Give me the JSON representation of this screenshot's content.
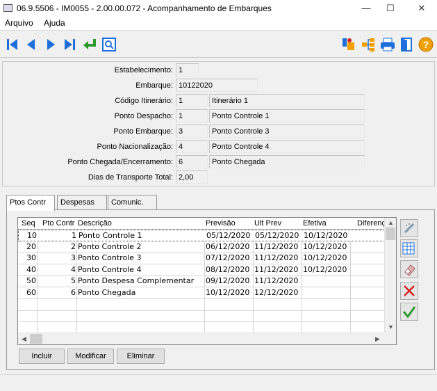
{
  "window": {
    "title": "06.9.5506 - IM0055 - 2.00.00.072 - Acompanhamento de Embarques",
    "minimize": "—",
    "maximize": "☐",
    "close": "✕"
  },
  "menu": [
    "Arquivo",
    "Ajuda"
  ],
  "toolbar": {
    "left": [
      "first-record-icon",
      "previous-record-icon",
      "next-record-icon",
      "last-record-icon",
      "goto-return-icon",
      "search-zoom-icon"
    ],
    "right": [
      "tools-icon",
      "tree-structure-icon",
      "print-icon",
      "exit-door-icon",
      "help-icon"
    ],
    "help_glyph": "?"
  },
  "form": {
    "estabelecimento": {
      "label": "Estabelecimento:",
      "value": "1"
    },
    "embarque": {
      "label": "Embarque:",
      "value": "10122020"
    },
    "codigo_itinerario": {
      "label": "Código Itinerário:",
      "value": "1",
      "desc": "Itinerário 1"
    },
    "ponto_despacho": {
      "label": "Ponto Despacho:",
      "value": "1",
      "desc": "Ponto Controle 1"
    },
    "ponto_embarque": {
      "label": "Ponto Embarque:",
      "value": "3",
      "desc": "Ponto Controle 3"
    },
    "ponto_nacionalizacao": {
      "label": "Ponto Nacionalização:",
      "value": "4",
      "desc": "Ponto Controle 4"
    },
    "ponto_chegada": {
      "label": "Ponto Chegada/Encerramento:",
      "value": "6",
      "desc": "Ponto Chegada"
    },
    "dias_transporte": {
      "label": "Dias de Transporte Total:",
      "value": "2,00"
    }
  },
  "tabs": [
    "Ptos Contr",
    "Despesas",
    "Comunic."
  ],
  "grid": {
    "columns": [
      "Seq",
      "Pto Contr",
      "Descrição",
      "Previsão",
      "Ult Prev",
      "Efetiva",
      "Diferenç"
    ],
    "rows": [
      [
        "10",
        "1",
        "Ponto Controle 1",
        "05/12/2020",
        "05/12/2020",
        "10/12/2020",
        ""
      ],
      [
        "20",
        "2",
        "Ponto Controle 2",
        "06/12/2020",
        "11/12/2020",
        "10/12/2020",
        ""
      ],
      [
        "30",
        "3",
        "Ponto Controle 3",
        "07/12/2020",
        "11/12/2020",
        "10/12/2020",
        ""
      ],
      [
        "40",
        "4",
        "Ponto Controle 4",
        "08/12/2020",
        "11/12/2020",
        "10/12/2020",
        ""
      ],
      [
        "50",
        "5",
        "Ponto Despesa Complementar",
        "09/12/2020",
        "11/12/2020",
        "",
        ""
      ],
      [
        "60",
        "6",
        "Ponto Chegada",
        "10/12/2020",
        "12/12/2020",
        "",
        ""
      ]
    ],
    "selected_row": 0
  },
  "side_actions": [
    "edit-pencil-icon",
    "grid-select-icon",
    "eraser-icon",
    "delete-x-icon",
    "confirm-check-icon"
  ],
  "buttons": {
    "incluir": "Incluir",
    "modificar": "Modificar",
    "eliminar": "Eliminar"
  },
  "colors": {
    "accent_blue": "#1e6fd9",
    "delete_red": "#d42020",
    "confirm_green": "#2e9a2e",
    "help_orange": "#f0a000"
  }
}
